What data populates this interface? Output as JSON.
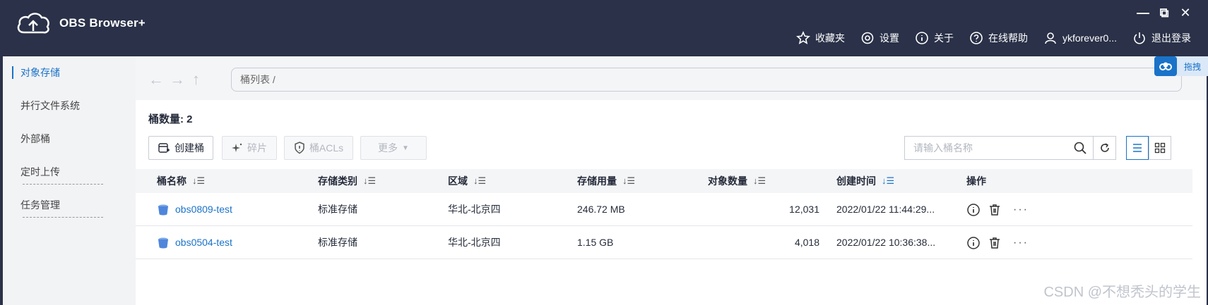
{
  "app": {
    "title": "OBS Browser+",
    "window_controls": [
      "—",
      "⧉",
      "✕"
    ]
  },
  "topnav": {
    "favorites": "收藏夹",
    "settings": "设置",
    "about": "关于",
    "help": "在线帮助",
    "user": "ykforever0...",
    "logout": "退出登录"
  },
  "float_widget": {
    "label": "拖拽"
  },
  "sidebar": {
    "items": [
      {
        "label": "对象存储",
        "active": true
      },
      {
        "label": "并行文件系统"
      },
      {
        "label": "外部桶"
      },
      {
        "label": "定时上传"
      },
      {
        "label": "任务管理"
      }
    ]
  },
  "breadcrumb": "桶列表 /",
  "bucket_count": "桶数量: 2",
  "toolbar": {
    "create": "创建桶",
    "fragments": "碎片",
    "acls": "桶ACLs",
    "more": "更多"
  },
  "search": {
    "placeholder": "请输入桶名称"
  },
  "table": {
    "columns": [
      "桶名称",
      "存储类别",
      "区域",
      "存储用量",
      "对象数量",
      "创建时间",
      "操作"
    ],
    "rows": [
      {
        "name": "obs0809-test",
        "class": "标准存储",
        "region": "华北-北京四",
        "usage": "246.72 MB",
        "objects": "12,031",
        "created": "2022/01/22 11:44:29..."
      },
      {
        "name": "obs0504-test",
        "class": "标准存储",
        "region": "华北-北京四",
        "usage": "1.15 GB",
        "objects": "4,018",
        "created": "2022/01/22 10:36:38..."
      }
    ],
    "more_ops": "···"
  },
  "watermark": "CSDN @不想秃头的学生",
  "colors": {
    "header_bg": "#2a3148",
    "accent": "#1a73c8",
    "sidebar_bg": "#f2f3f5",
    "table_head_bg": "#f4f5f7"
  }
}
